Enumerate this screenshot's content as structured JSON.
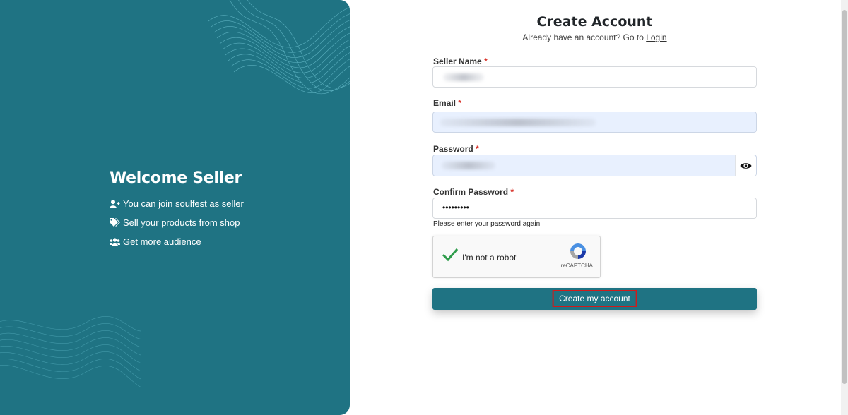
{
  "left_panel": {
    "heading": "Welcome Seller",
    "features": [
      {
        "icon": "user-plus-icon",
        "text": "You can join soulfest as seller"
      },
      {
        "icon": "tags-icon",
        "text": "Sell your products from shop"
      },
      {
        "icon": "users-icon",
        "text": "Get more audience"
      }
    ]
  },
  "form": {
    "title": "Create Account",
    "subtitle_prefix": "Already have an account? Go to ",
    "login_link": "Login",
    "seller_name": {
      "label": "Seller Name",
      "required_mark": "*",
      "value": ""
    },
    "email": {
      "label": "Email",
      "required_mark": "*",
      "value": ""
    },
    "password": {
      "label": "Password",
      "required_mark": "*",
      "value": "",
      "toggle_icon": "eye-icon"
    },
    "confirm_password": {
      "label": "Confirm Password",
      "required_mark": "*",
      "value": "•••••••••",
      "hint": "Please enter your password again"
    },
    "recaptcha": {
      "label": "I'm not a robot",
      "brand": "reCAPTCHA",
      "checked": true
    },
    "submit_label": "Create my account"
  },
  "colors": {
    "panel": "#1f7383",
    "button": "#1f7383",
    "required": "#d9342b",
    "highlight_border": "#d11a1a",
    "autofill": "#e8f0fe"
  }
}
